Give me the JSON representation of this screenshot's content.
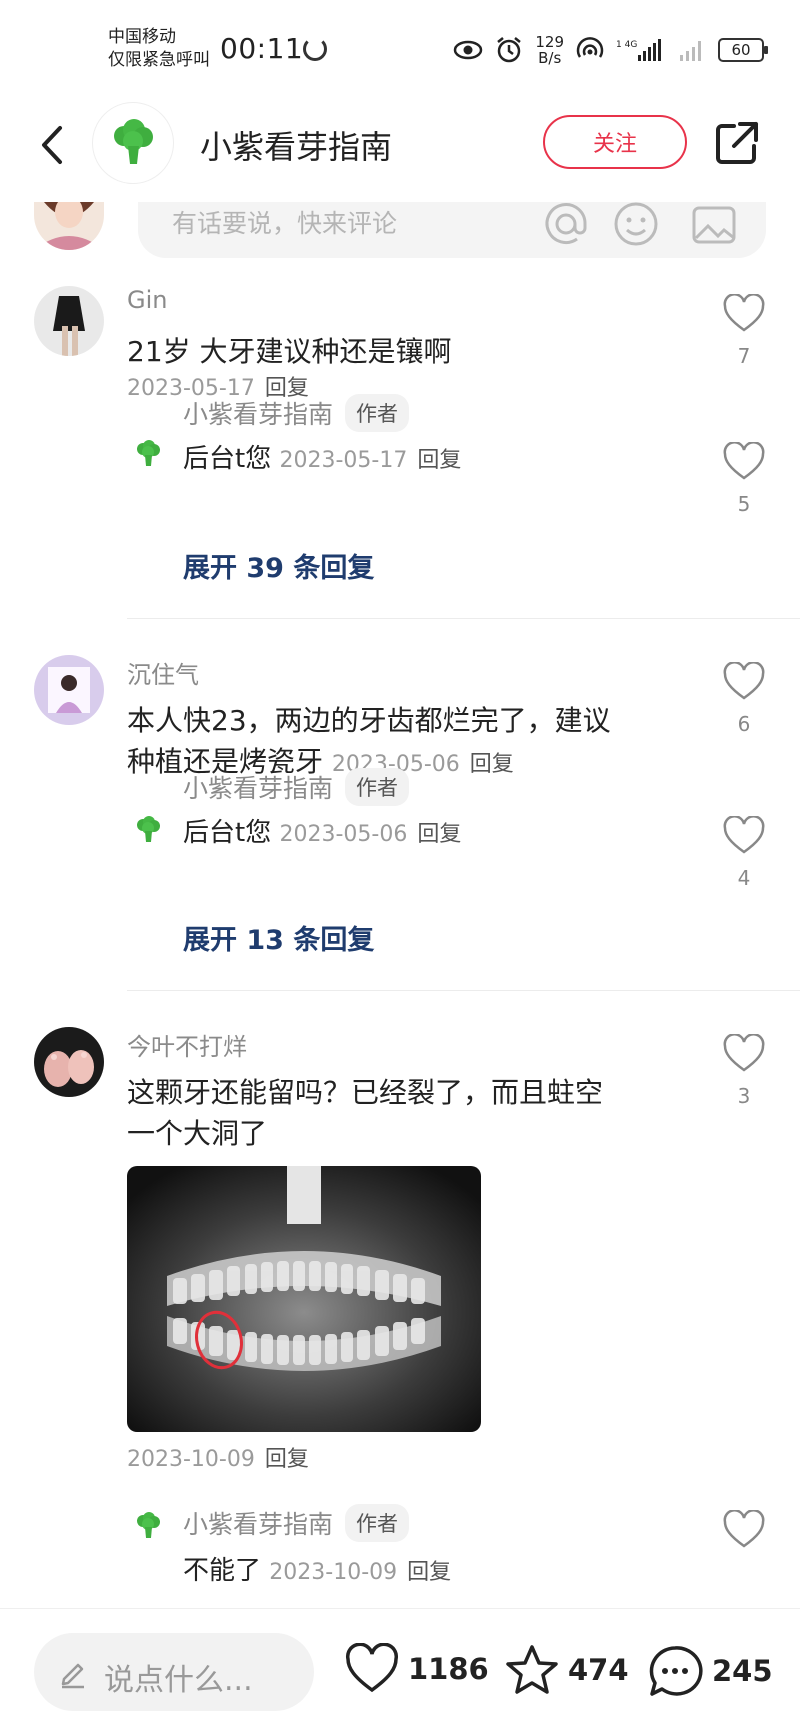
{
  "status_bar": {
    "carrier_line1": "中国移动",
    "carrier_line2": "仅限紧急呼叫",
    "time": "00:11",
    "net_speed_value": "129",
    "net_speed_unit": "B/s",
    "battery": "60"
  },
  "header": {
    "title": "小紫看芽指南",
    "follow_label": "关注"
  },
  "comment_input": {
    "placeholder": "有话要说，快来评论"
  },
  "comments": [
    {
      "name": "Gin",
      "text": "21岁 大牙建议种还是镶啊",
      "date": "2023-05-17",
      "reply_label": "回复",
      "likes": "7",
      "sub_reply": {
        "name": "小紫看芽指南",
        "tag": "作者",
        "text": "后台t您",
        "date": "2023-05-17",
        "reply_label": "回复",
        "likes": "5"
      },
      "expand_label": "展开 39 条回复"
    },
    {
      "name": "沉住气",
      "text_line1": "本人快23，两边的牙齿都烂完了，建议",
      "text_line2": "种植还是烤瓷牙",
      "date": "2023-05-06",
      "reply_label": "回复",
      "likes": "6",
      "sub_reply": {
        "name": "小紫看芽指南",
        "tag": "作者",
        "text": "后台t您",
        "date": "2023-05-06",
        "reply_label": "回复",
        "likes": "4"
      },
      "expand_label": "展开 13 条回复"
    },
    {
      "name": "今叶不打烊",
      "text_line1": "这颗牙还能留吗？已经裂了，而且蛀空",
      "text_line2": "一个大洞了",
      "date": "2023-10-09",
      "reply_label": "回复",
      "likes": "3",
      "sub_reply": {
        "name": "小紫看芽指南",
        "tag": "作者",
        "text": "不能了",
        "date": "2023-10-09",
        "reply_label": "回复"
      }
    }
  ],
  "bottom_bar": {
    "say_placeholder": "说点什么...",
    "likes": "1186",
    "stars": "474",
    "comments": "245"
  },
  "colors": {
    "accent": "#e8334a",
    "link": "#1f3c6e",
    "brand_green": "#3fae3f"
  },
  "icons": [
    "back-arrow-icon",
    "broccoli-logo-icon",
    "share-icon",
    "at-icon",
    "emoji-icon",
    "image-icon",
    "heart-icon",
    "star-icon",
    "chat-bubble-icon",
    "pencil-icon",
    "eye-icon",
    "alarm-icon",
    "hotspot-icon",
    "signal-icon",
    "battery-icon"
  ]
}
